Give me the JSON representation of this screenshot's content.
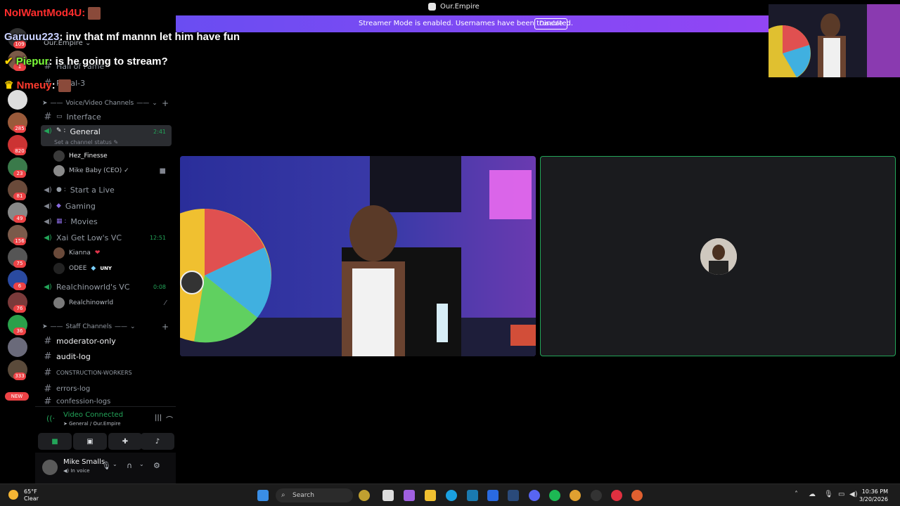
{
  "window": {
    "title": "Our.Empire"
  },
  "banner": {
    "message": "Streamer Mode is enabled. Usernames have been truncated.",
    "button": "Disable"
  },
  "chat_overlay": [
    {
      "user": "NoIWantMod4U",
      "text": "",
      "color": "#ff2d2d"
    },
    {
      "user": "Garuuu223",
      "text": "inv that mf mannn let him have fun",
      "color": "#ffffff"
    },
    {
      "user": "Piepur",
      "text": "is he going to stream?",
      "color": "#7dff3a"
    },
    {
      "user": "Nmeuy",
      "text": "",
      "color": "#ff3b2e"
    }
  ],
  "servers": {
    "badges": [
      "109",
      "1",
      "285",
      "820",
      "23",
      "81",
      "49",
      "156",
      "75",
      "6",
      "76",
      "36",
      "333"
    ],
    "new_label": "NEW"
  },
  "channels": {
    "server_name": "Our.Empire",
    "top_items": [
      "Hall of Fame",
      "Royal-3"
    ],
    "voice_category": "Voice/Video Channels",
    "voice": [
      {
        "name": "Interface",
        "time": ""
      },
      {
        "name": "General",
        "time": "2:41",
        "status": "Set a channel status"
      },
      {
        "name": "Start a Live",
        "time": ""
      },
      {
        "name": "Gaming",
        "time": ""
      },
      {
        "name": "Movies",
        "time": ""
      },
      {
        "name": "Xai Get Low's VC",
        "time": "12:51"
      },
      {
        "name": "Realchinowrld's VC",
        "time": "0:08"
      }
    ],
    "general_members": [
      "Hez_Finesse",
      "Mike Baby (CEO) ✓"
    ],
    "xai_members": [
      "Kianna",
      "ODEE"
    ],
    "xai_tag": "UNY",
    "real_members": [
      "Realchinowrld"
    ],
    "staff_category": "Staff Channels",
    "staff": [
      "moderator-only",
      "audit-log",
      "CONSTRUCTION-WORKERS",
      "errors-log",
      "confession-logs"
    ]
  },
  "voice_connection": {
    "status": "Video Connected",
    "location": "General / Our.Empire"
  },
  "user_panel": {
    "name": "Mike Smalls",
    "status": "In voice"
  },
  "taskbar": {
    "temp": "65°F",
    "condition": "Clear",
    "search_placeholder": "Search",
    "time": "10:36 PM",
    "date": "3/20/2026"
  }
}
